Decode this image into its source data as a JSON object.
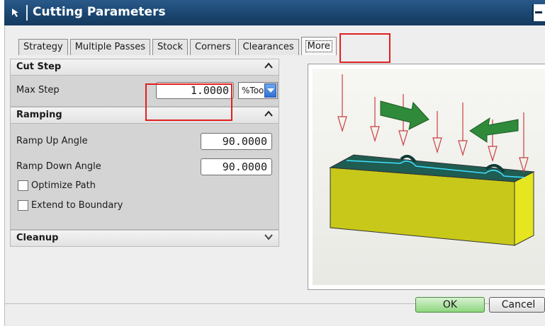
{
  "window": {
    "title": "Cutting Parameters"
  },
  "tabs": [
    {
      "label": "Strategy"
    },
    {
      "label": "Multiple Passes"
    },
    {
      "label": "Stock"
    },
    {
      "label": "Corners"
    },
    {
      "label": "Clearances"
    },
    {
      "label": "More",
      "active": true
    }
  ],
  "sections": {
    "cut_step": {
      "title": "Cut Step",
      "max_step_label": "Max Step",
      "max_step_value": "1.0000",
      "max_step_unit": "%Tool"
    },
    "ramping": {
      "title": "Ramping",
      "ramp_up_label": "Ramp Up Angle",
      "ramp_up_value": "90.0000",
      "ramp_down_label": "Ramp Down Angle",
      "ramp_down_value": "90.0000",
      "optimize_path_label": "Optimize Path",
      "optimize_path_checked": false,
      "extend_boundary_label": "Extend to Boundary",
      "extend_boundary_checked": false
    },
    "cleanup": {
      "title": "Cleanup"
    }
  },
  "buttons": {
    "ok": "OK",
    "cancel": "Cancel"
  },
  "colors": {
    "title_bar": "#1b4670",
    "highlight": "#e02020",
    "part_top": "#1f5c52",
    "part_side": "#c8c81a",
    "arrow_green": "#2f8a3a",
    "tool_red": "#c84040"
  },
  "icons": {
    "cursor": "cursor-icon",
    "collapse": "chevron-up-icon",
    "expand": "chevron-down-icon",
    "dropdown": "dropdown-arrow-icon"
  }
}
